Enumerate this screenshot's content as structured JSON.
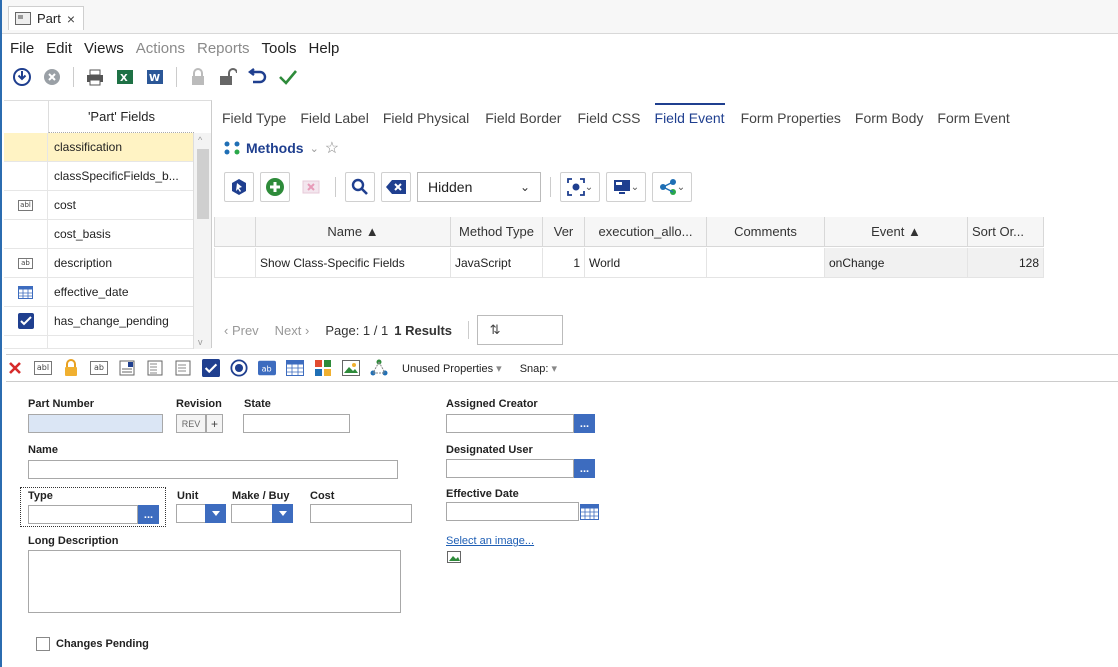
{
  "tab": {
    "title": "Part",
    "close": "×"
  },
  "menu": [
    {
      "label": "File",
      "enabled": true
    },
    {
      "label": "Edit",
      "enabled": true
    },
    {
      "label": "Views",
      "enabled": true
    },
    {
      "label": "Actions",
      "enabled": false
    },
    {
      "label": "Reports",
      "enabled": false
    },
    {
      "label": "Tools",
      "enabled": true
    },
    {
      "label": "Help",
      "enabled": true
    }
  ],
  "fields_panel": {
    "header": "'Part' Fields",
    "items": [
      {
        "label": "classification",
        "icon": "none",
        "selected": true
      },
      {
        "label": "classSpecificFields_b...",
        "icon": "none"
      },
      {
        "label": "cost",
        "icon": "text-field-icon"
      },
      {
        "label": "cost_basis",
        "icon": "none"
      },
      {
        "label": "description",
        "icon": "text-area-icon"
      },
      {
        "label": "effective_date",
        "icon": "date-field-icon"
      },
      {
        "label": "has_change_pending",
        "icon": "checkbox-icon"
      }
    ]
  },
  "prop_tabs": [
    "Field Type",
    "Field Label",
    "Field Physical",
    "Field Border",
    "Field CSS",
    "Field Event",
    "Form Properties",
    "Form Body",
    "Form Event"
  ],
  "active_prop_tab": "Field Event",
  "methods": {
    "title": "Methods",
    "view_select": "Hidden"
  },
  "grid": {
    "columns": [
      "Name ▲",
      "Method Type",
      "Ver",
      "execution_allo...",
      "Comments",
      "Event ▲",
      "Sort Or..."
    ],
    "rows": [
      {
        "name": "Show Class-Specific Fields",
        "method_type": "JavaScript",
        "ver": "1",
        "execution": "World",
        "comments": "",
        "event": "onChange",
        "sort": "128"
      }
    ]
  },
  "pager": {
    "prev": "‹ Prev",
    "next": "Next ›",
    "page": "Page: 1 / 1",
    "results": "1 Results"
  },
  "designer": {
    "unused": "Unused Properties",
    "snap": "Snap:"
  },
  "form": {
    "part_number": "Part Number",
    "revision": "Revision",
    "rev_value": "REV",
    "rev_plus": "+",
    "state": "State",
    "name": "Name",
    "type": "Type",
    "unit": "Unit",
    "make_buy": "Make / Buy",
    "cost": "Cost",
    "long_description": "Long Description",
    "assigned_creator": "Assigned Creator",
    "designated_user": "Designated User",
    "effective_date": "Effective Date",
    "select_image": "Select an image...",
    "changes_pending": "Changes Pending",
    "dots": "..."
  },
  "colors": {
    "accent": "#1f3f8f",
    "field_button": "#3d6cbf",
    "selected_row": "#fff3c4",
    "part_number_bg": "#dbe6f5"
  }
}
